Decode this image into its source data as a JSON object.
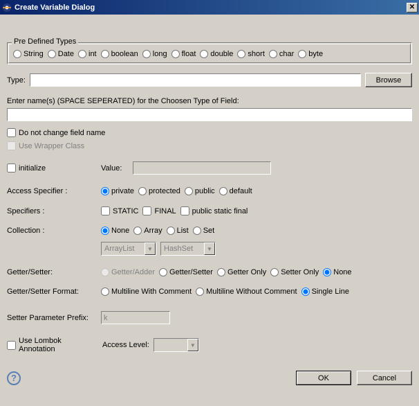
{
  "title": "Create Variable Dialog",
  "predefgroup": {
    "legend": "Pre Defined Types",
    "options": [
      "String",
      "Date",
      "int",
      "boolean",
      "long",
      "float",
      "double",
      "short",
      "char",
      "byte"
    ]
  },
  "type": {
    "label": "Type:",
    "value": "",
    "browse": "Browse"
  },
  "names": {
    "label": "Enter name(s) (SPACE SEPERATED) for the Choosen Type of Field:",
    "value": ""
  },
  "noChange": "Do not change field name",
  "wrapper": "Use Wrapper Class",
  "initialize": {
    "label": "initialize",
    "valueLabel": "Value:",
    "value": ""
  },
  "access": {
    "label": "Access Specifier :",
    "options": [
      "private",
      "protected",
      "public",
      "default"
    ]
  },
  "specifiers": {
    "label": "Specifiers :",
    "options": [
      "STATIC",
      "FINAL",
      "public static final"
    ]
  },
  "collection": {
    "label": "Collection :",
    "options": [
      "None",
      "Array",
      "List",
      "Set"
    ],
    "dd1": "ArrayList",
    "dd2": "HashSet"
  },
  "getset": {
    "label": "Getter/Setter:",
    "options": [
      "Getter/Adder",
      "Getter/Setter",
      "Getter Only",
      "Setter Only",
      "None"
    ]
  },
  "getsetfmt": {
    "label": "Getter/Setter Format:",
    "options": [
      "Multiline With Comment",
      "Multiline Without Comment",
      "Single Line"
    ]
  },
  "setterprefix": {
    "label": "Setter Parameter Prefix:",
    "value": "k"
  },
  "lombok": {
    "label": "Use Lombok Annotation",
    "accessLabel": "Access Level:",
    "value": ""
  },
  "ok": "OK",
  "cancel": "Cancel"
}
